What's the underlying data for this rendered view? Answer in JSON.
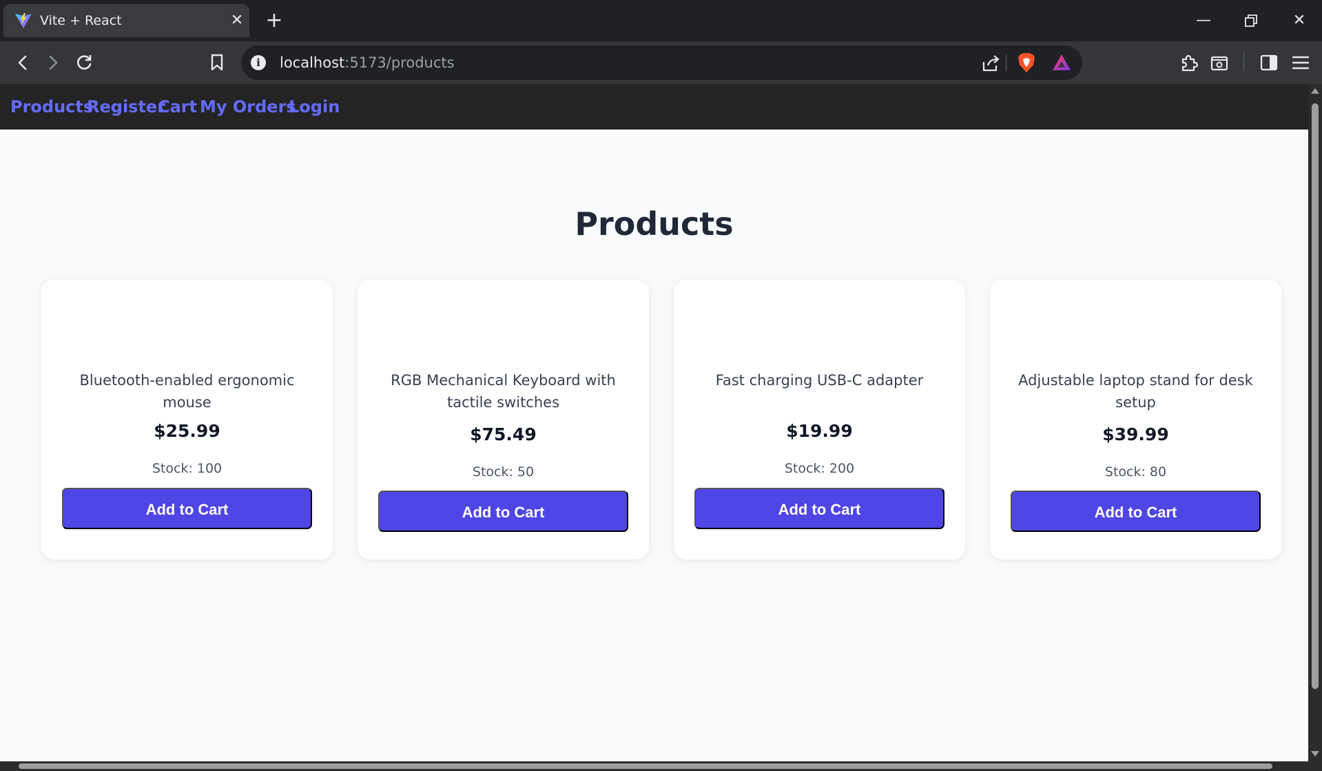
{
  "browser": {
    "tab_title": "Vite + React",
    "tab_close_icon": "close-icon",
    "new_tab_icon": "plus-icon",
    "url_host": "localhost",
    "url_path": ":5173/products",
    "window_controls": [
      "minimize-icon",
      "restore-icon",
      "close-icon"
    ]
  },
  "nav": {
    "links": [
      {
        "label": "Products"
      },
      {
        "label": "Register"
      },
      {
        "label": "Cart"
      },
      {
        "label": "My Orders"
      },
      {
        "label": "Login"
      }
    ]
  },
  "page": {
    "title": "Products"
  },
  "products": [
    {
      "description": "Bluetooth-enabled ergonomic mouse",
      "price": "$25.99",
      "stock": "Stock: 100",
      "button": "Add to Cart"
    },
    {
      "description": "RGB Mechanical Keyboard with tactile switches",
      "price": "$75.49",
      "stock": "Stock: 50",
      "button": "Add to Cart"
    },
    {
      "description": "Fast charging USB-C adapter",
      "price": "$19.99",
      "stock": "Stock: 200",
      "button": "Add to Cart"
    },
    {
      "description": "Adjustable laptop stand for desk setup",
      "price": "$39.99",
      "stock": "Stock: 80",
      "button": "Add to Cart"
    }
  ],
  "colors": {
    "accent": "#4f46e5",
    "nav_link": "#646cff",
    "navbar_bg": "#242424",
    "page_bg": "#f9fafb"
  }
}
